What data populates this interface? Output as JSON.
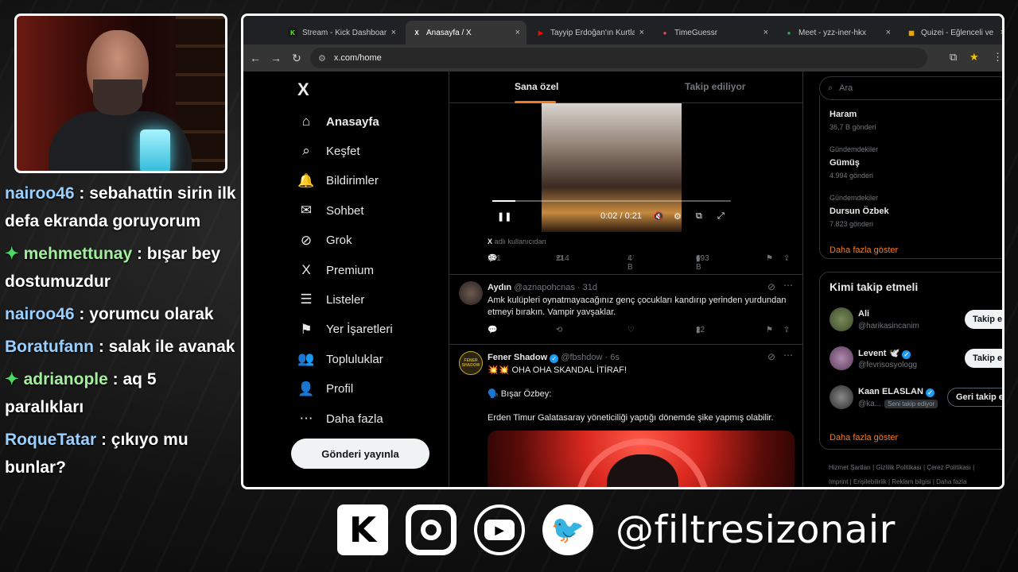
{
  "chat": [
    {
      "user": "nairoo46",
      "text": ": sebahattin sirin ilk defa ekranda goruyorum",
      "gem": false
    },
    {
      "user": "mehmettunay",
      "text": ": bışar bey dostumuzdur",
      "gem": true
    },
    {
      "user": "nairoo46",
      "text": ": yorumcu olarak",
      "gem": false
    },
    {
      "user": "Boratufann",
      "text": ": salak ile avanak",
      "gem": false
    },
    {
      "user": "adrianople",
      "text": ": aq 5 paralıkları",
      "gem": true
    },
    {
      "user": "RoqueTatar",
      "text": ": çıkıyo mu bunlar?",
      "gem": false
    }
  ],
  "browser": {
    "tabs": [
      {
        "title": "Stream - Kick Dashboard",
        "icon": "K",
        "color": "#53fc18",
        "active": false
      },
      {
        "title": "Anasayfa / X",
        "icon": "X",
        "color": "#ffffff",
        "active": true
      },
      {
        "title": "Tayyip Erdoğan'ın Kurtla",
        "icon": "▶",
        "color": "#ff0000",
        "active": false
      },
      {
        "title": "TimeGuessr",
        "icon": "●",
        "color": "#e05050",
        "active": false
      },
      {
        "title": "Meet - yzz-iner-hkx",
        "icon": "●",
        "color": "#34a853",
        "active": false
      },
      {
        "title": "Quizei - Eğlenceli ve eti",
        "icon": "▦",
        "color": "#f4b400",
        "active": false
      }
    ],
    "url": "x.com/home",
    "close_glyph": "×"
  },
  "nav": {
    "logo": "X",
    "items": [
      {
        "label": "Anasayfa",
        "icon": "⌂",
        "name": "home",
        "bold": true
      },
      {
        "label": "Keşfet",
        "icon": "⌕",
        "name": "explore",
        "bold": false
      },
      {
        "label": "Bildirimler",
        "icon": "🔔",
        "name": "notifications",
        "bold": false
      },
      {
        "label": "Sohbet",
        "icon": "✉",
        "name": "chat",
        "bold": false
      },
      {
        "label": "Grok",
        "icon": "⊘",
        "name": "grok",
        "bold": false
      },
      {
        "label": "Premium",
        "icon": "X",
        "name": "premium",
        "bold": false
      },
      {
        "label": "Listeler",
        "icon": "☰",
        "name": "lists",
        "bold": false
      },
      {
        "label": "Yer İşaretleri",
        "icon": "⚑",
        "name": "bookmarks",
        "bold": false
      },
      {
        "label": "Topluluklar",
        "icon": "👥",
        "name": "communities",
        "bold": false
      },
      {
        "label": "Profil",
        "icon": "👤",
        "name": "profile",
        "bold": false
      },
      {
        "label": "Daha fazla",
        "icon": "⋯",
        "name": "more",
        "bold": false
      }
    ],
    "post_button": "Gönderi yayınla"
  },
  "timeline": {
    "tabs": {
      "for_you": "Sana özel",
      "following": "Takip ediliyor"
    },
    "video": {
      "time": "0:02 / 0:21",
      "progress": 0.095,
      "play_icon": "❚❚",
      "mute_icon": "🔇",
      "settings_icon": "⚙",
      "pip_icon": "⧉",
      "fullscreen_icon": "⤢"
    },
    "source_prefix": "X",
    "source_text": "adlı kullanıcıdan",
    "tweet1_stats": {
      "replies": "331",
      "retweets": "214",
      "likes": "4 B",
      "views": "693 B"
    },
    "tweet2": {
      "name": "Aydın",
      "handle": "@aznapohcnas",
      "time": "· 31d",
      "text": "Amk kulüpleri oynatmayacağınız genç çocukları kandırıp yerinden yurdundan etmeyi bırakın. Vampir yavşaklar.",
      "views": "22"
    },
    "tweet3": {
      "name": "Fener Shadow",
      "handle": "@fbshdow",
      "time": "· 6s",
      "line1": "💥💥 OHA OHA SKANDAL İTİRAF!",
      "line2": "🗣️ Bışar Özbey:",
      "line3": "Erden Timur Galatasaray yöneticiliği yaptığı dönemde şike yapmış olabilir.",
      "avatar_text": "FENER SHADOW"
    }
  },
  "right": {
    "search_placeholder": "Ara",
    "trends": [
      {
        "category": "",
        "name": "Haram",
        "count": "36,7 B gönderi"
      },
      {
        "category": "Gündemdekiler",
        "name": "Gümüş",
        "count": "4.994 gönderi"
      },
      {
        "category": "Gündemdekiler",
        "name": "Dursun Özbek",
        "count": "7.823 gönderi"
      }
    ],
    "show_more": "Daha fazla göster",
    "who_to_follow_title": "Kimi takip etmeli",
    "suggestions": [
      {
        "name": "Ali",
        "handle": "@harikasincanim",
        "verified": false,
        "badge": "",
        "button": "Takip et",
        "following": false
      },
      {
        "name": "Levent 🕊️",
        "handle": "@fevrisosyologg",
        "verified": true,
        "badge": "",
        "button": "Takip et",
        "following": false
      },
      {
        "name": "Kaan ELASLAN",
        "handle": "@ka...",
        "verified": true,
        "badge": "Seni takip ediyor",
        "button": "Geri takip et",
        "following": true
      }
    ],
    "show_more_2": "Daha fazla göster",
    "footer_line1": "Hizmet Şartları  |  Gizlilik Politikası  |  Çerez Politikası  |",
    "footer_line2": "Imprint  |  Erişilebilirlik  |  Reklam bilgisi  |  Daha fazla"
  },
  "social": {
    "handle": "@filtresizonair",
    "icons": [
      "kick-icon",
      "instagram-icon",
      "youtube-icon",
      "twitter-icon"
    ]
  }
}
